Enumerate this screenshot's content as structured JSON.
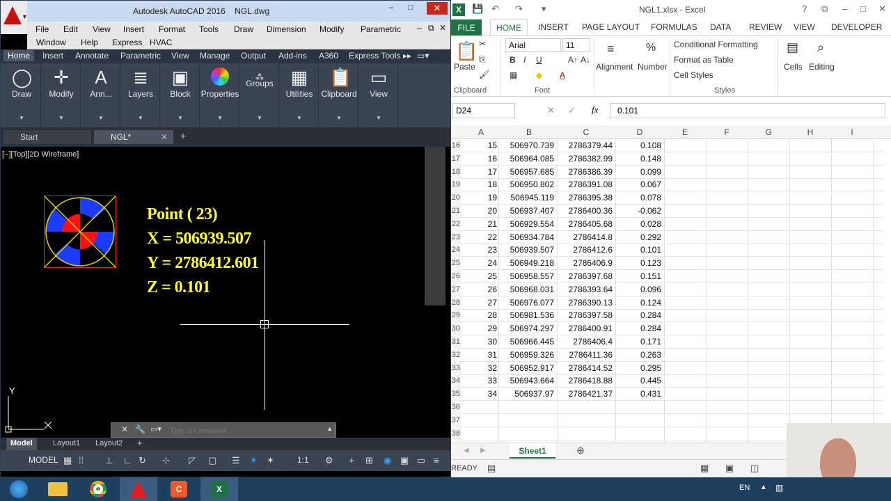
{
  "acad": {
    "app_title": "Autodesk AutoCAD 2016",
    "file_title": "NGL.dwg",
    "window_buttons": [
      "–",
      "□",
      "✕"
    ],
    "menu_row1": [
      "File",
      "Edit",
      "View",
      "Insert",
      "Format",
      "Tools",
      "Draw",
      "Dimension",
      "Modify",
      "Parametric"
    ],
    "menu_row2": [
      "Window",
      "Help",
      "Express",
      "HVAC"
    ],
    "ribbon_tabs": [
      "Home",
      "Insert",
      "Annotate",
      "Parametric",
      "View",
      "Manage",
      "Output",
      "Add-ins",
      "A360",
      "Express Tools"
    ],
    "ribbon_panels": [
      "Draw",
      "Modify",
      "Ann...",
      "Layers",
      "Block",
      "Properties",
      "Groups",
      "Utilities",
      "Clipboard",
      "View"
    ],
    "doc_tabs": {
      "start": "Start",
      "drawing": "NGL*"
    },
    "viewport_label": "[−][Top][2D Wireframe]",
    "drawing_text": {
      "point": "Point ( 23)",
      "x": "X = 506939.507",
      "y": "Y = 2786412.601",
      "z": "Z = 0.101"
    },
    "ucs_label": "Y",
    "command_placeholder": "Type a command",
    "layout_tabs": [
      "Model",
      "Layout1",
      "Layout2"
    ],
    "status_model": "MODEL",
    "status_scale": "1:1",
    "colors": {
      "text": "#ffff33",
      "marker_blue": "#1a3cff",
      "marker_red": "#ff1111"
    }
  },
  "excel": {
    "title": "NGL1.xlsx - Excel",
    "tabs": [
      "FILE",
      "HOME",
      "INSERT",
      "PAGE LAYOUT",
      "FORMULAS",
      "DATA",
      "REVIEW",
      "VIEW",
      "DEVELOPER"
    ],
    "font_name": "Arial",
    "font_size": "11",
    "groups": {
      "clipboard": "Clipboard",
      "font": "Font",
      "styles": "Styles"
    },
    "buttons": {
      "paste": "Paste",
      "alignment": "Alignment",
      "number": "Number",
      "conditional": "Conditional Formatting",
      "format_table": "Format as Table",
      "cell_styles": "Cell Styles",
      "cells": "Cells",
      "editing": "Editing"
    },
    "name_box": "D24",
    "formula_value": "0.101",
    "columns": [
      "A",
      "B",
      "C",
      "D",
      "E",
      "F",
      "G",
      "H",
      "I"
    ],
    "rows": [
      {
        "rn": "16",
        "a": "15",
        "b": "506970.739",
        "c": "2786379.44",
        "d": "0.108"
      },
      {
        "rn": "17",
        "a": "16",
        "b": "506964.085",
        "c": "2786382.99",
        "d": "0.148"
      },
      {
        "rn": "18",
        "a": "17",
        "b": "506957.685",
        "c": "2786386.39",
        "d": "0.099"
      },
      {
        "rn": "19",
        "a": "18",
        "b": "506950.802",
        "c": "2786391.08",
        "d": "0.067"
      },
      {
        "rn": "20",
        "a": "19",
        "b": "506945.119",
        "c": "2786395.38",
        "d": "0.078"
      },
      {
        "rn": "21",
        "a": "20",
        "b": "506937.407",
        "c": "2786400.36",
        "d": "-0.062"
      },
      {
        "rn": "22",
        "a": "21",
        "b": "506929.554",
        "c": "2786405.68",
        "d": "0.028"
      },
      {
        "rn": "23",
        "a": "22",
        "b": "506934.784",
        "c": "2786414.8",
        "d": "0.292"
      },
      {
        "rn": "24",
        "a": "23",
        "b": "506939.507",
        "c": "2786412.6",
        "d": "0.101"
      },
      {
        "rn": "25",
        "a": "24",
        "b": "506949.218",
        "c": "2786406.9",
        "d": "0.123"
      },
      {
        "rn": "26",
        "a": "25",
        "b": "506958.557",
        "c": "2786397.68",
        "d": "0.151"
      },
      {
        "rn": "27",
        "a": "26",
        "b": "506968.031",
        "c": "2786393.64",
        "d": "0.096"
      },
      {
        "rn": "28",
        "a": "27",
        "b": "506976.077",
        "c": "2786390.13",
        "d": "0.124"
      },
      {
        "rn": "29",
        "a": "28",
        "b": "506981.536",
        "c": "2786397.58",
        "d": "0.284"
      },
      {
        "rn": "30",
        "a": "29",
        "b": "506974.297",
        "c": "2786400.91",
        "d": "0.284"
      },
      {
        "rn": "31",
        "a": "30",
        "b": "506966.445",
        "c": "2786406.4",
        "d": "0.171"
      },
      {
        "rn": "32",
        "a": "31",
        "b": "506959.326",
        "c": "2786411.36",
        "d": "0.263"
      },
      {
        "rn": "33",
        "a": "32",
        "b": "506952.917",
        "c": "2786414.52",
        "d": "0.295"
      },
      {
        "rn": "34",
        "a": "33",
        "b": "506943.664",
        "c": "2786418.88",
        "d": "0.445"
      },
      {
        "rn": "35",
        "a": "34",
        "b": "506937.97",
        "c": "2786421.37",
        "d": "0.431"
      },
      {
        "rn": "36",
        "a": "",
        "b": "",
        "c": "",
        "d": ""
      },
      {
        "rn": "37",
        "a": "",
        "b": "",
        "c": "",
        "d": ""
      },
      {
        "rn": "38",
        "a": "",
        "b": "",
        "c": "",
        "d": ""
      }
    ],
    "sheet_tab": "Sheet1",
    "status": "READY",
    "accent": "#217346"
  },
  "taskbar": {
    "lang": "EN"
  }
}
